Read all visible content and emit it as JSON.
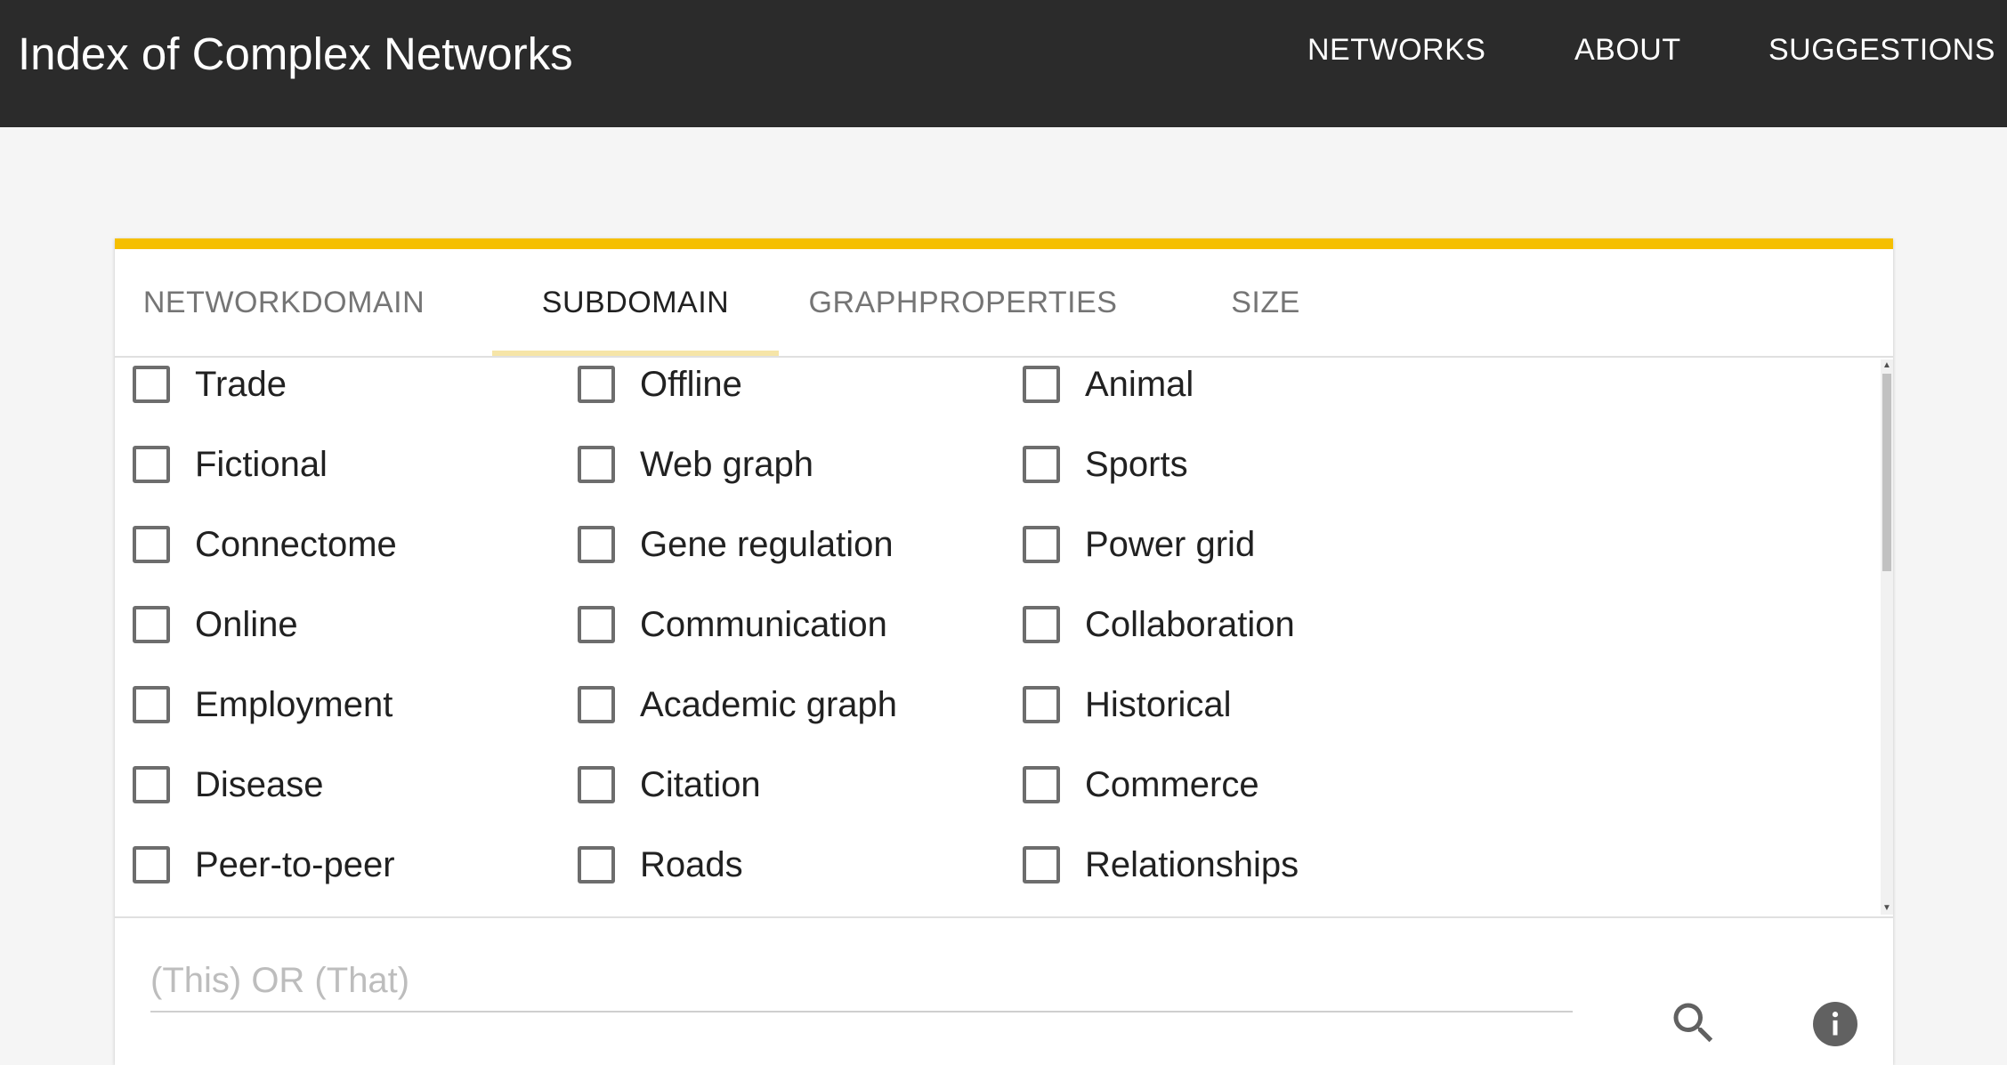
{
  "header": {
    "title": "Index of Complex Networks",
    "nav": [
      {
        "label": "NETWORKS"
      },
      {
        "label": "ABOUT"
      },
      {
        "label": "SUGGESTIONS"
      }
    ]
  },
  "tabs": [
    {
      "label": "NETWORKDOMAIN",
      "active": false
    },
    {
      "label": "SUBDOMAIN",
      "active": true
    },
    {
      "label": "GRAPHPROPERTIES",
      "active": false
    },
    {
      "label": "SIZE",
      "active": false
    }
  ],
  "subdomains": {
    "column1": [
      "Trade",
      "Fictional",
      "Connectome",
      "Online",
      "Employment",
      "Disease",
      "Peer-to-peer"
    ],
    "column2": [
      "Offline",
      "Web graph",
      "Gene regulation",
      "Communication",
      "Academic graph",
      "Citation",
      "Roads"
    ],
    "column3": [
      "Animal",
      "Sports",
      "Power grid",
      "Collaboration",
      "Historical",
      "Commerce",
      "Relationships"
    ]
  },
  "search": {
    "value": "",
    "placeholder": "(This) OR (That)"
  },
  "colors": {
    "topbar": "#2b2b2b",
    "accent": "#f5bf00",
    "tab_indicator": "#f6e5a8",
    "checkbox_border": "#6d6d6d",
    "info_icon": "#616161"
  },
  "icons": {
    "search": "search-icon",
    "info": "info-icon"
  }
}
